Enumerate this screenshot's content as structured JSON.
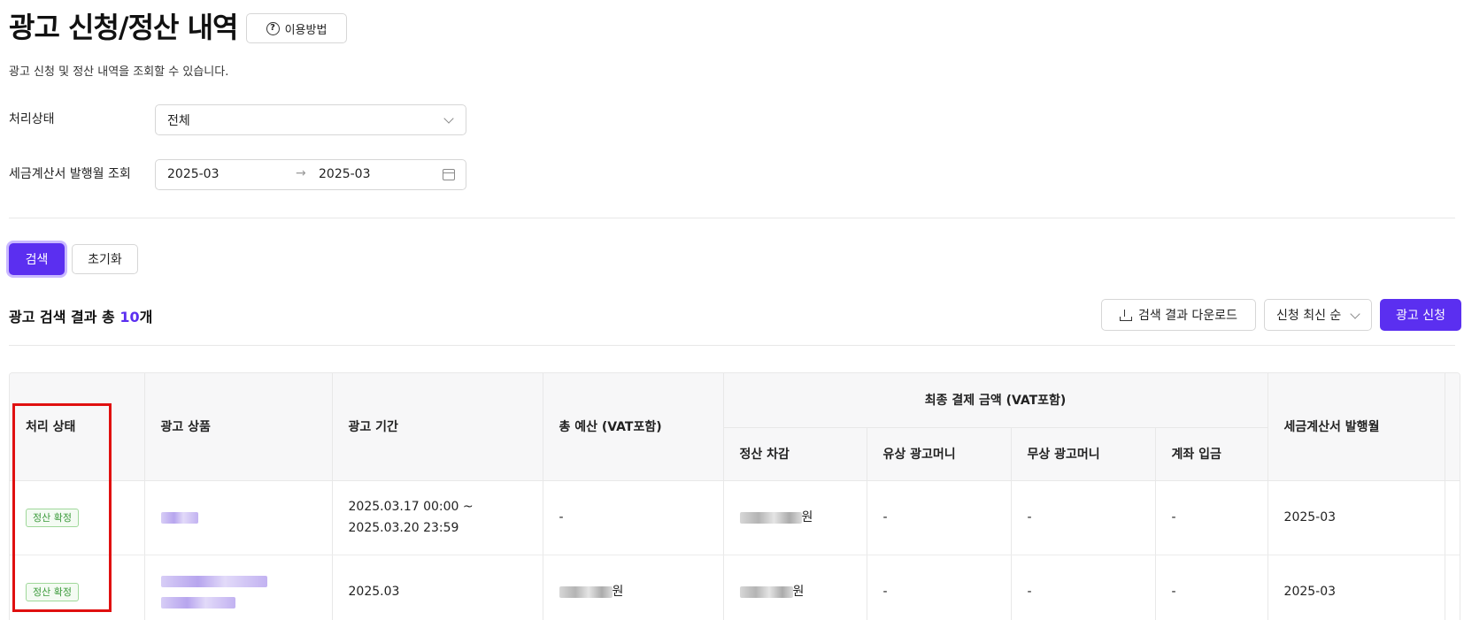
{
  "header": {
    "title": "광고 신청/정산 내역",
    "help_label": "이용방법",
    "subtitle": "광고 신청 및 정산 내역을 조회할 수 있습니다."
  },
  "filters": {
    "status_label": "처리상태",
    "status_value": "전체",
    "date_label": "세금계산서 발행월 조회",
    "date_start": "2025-03",
    "date_arrow": "→",
    "date_end": "2025-03"
  },
  "actions": {
    "search_label": "검색",
    "reset_label": "초기화"
  },
  "results": {
    "summary_prefix": "광고 검색 결과 총 ",
    "count": "10",
    "summary_suffix": "개",
    "download_label": "검색 결과 다운로드",
    "sort_label": "신청 최신 순",
    "apply_label": "광고 신청"
  },
  "table": {
    "headers": {
      "status": "처리 상태",
      "product": "광고 상품",
      "period": "광고 기간",
      "budget": "총 예산 (VAT포함)",
      "final_payment": "최종 결제 금액 (VAT포함)",
      "settlement_deduct": "정산 차감",
      "paid_money": "유상 광고머니",
      "free_money": "무상 광고머니",
      "bank_deposit": "계좌 입금",
      "tax_invoice_month": "세금계산서 발행월"
    },
    "rows": [
      {
        "status": "정산 확정",
        "period_line1": "2025.03.17 00:00 ~",
        "period_line2": "2025.03.20 23:59",
        "budget": "-",
        "settlement_suffix": "원",
        "paid_money": "-",
        "free_money": "-",
        "bank_deposit": "-",
        "tax_invoice_month": "2025-03"
      },
      {
        "status": "정산 확정",
        "period_line1": "2025.03",
        "budget_suffix": "원",
        "settlement_suffix": "원",
        "paid_money": "-",
        "free_money": "-",
        "bank_deposit": "-",
        "tax_invoice_month": "2025-03"
      }
    ]
  },
  "colors": {
    "accent": "#5b2ff0",
    "highlight": "#e01010",
    "status_green": "#3a9a3a"
  }
}
